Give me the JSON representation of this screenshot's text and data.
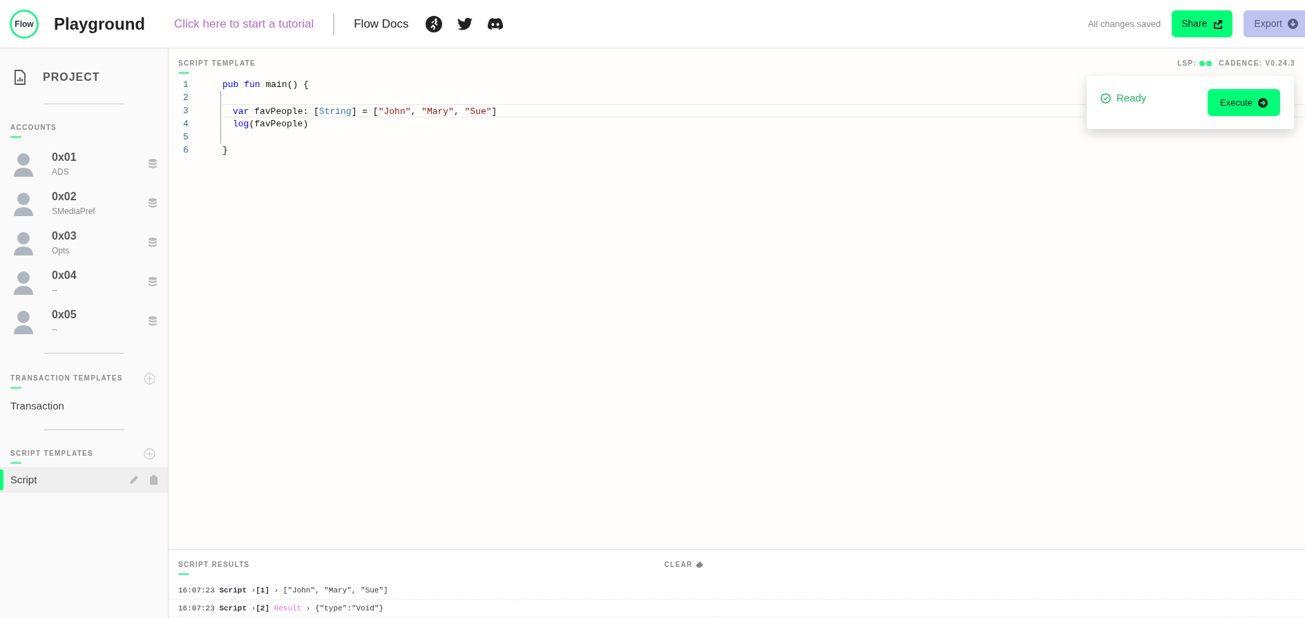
{
  "header": {
    "logo": "Flow",
    "title": "Playground",
    "tutorial_link": "Click here to start a tutorial",
    "docs_link": "Flow Docs",
    "save_status": "All changes saved",
    "share_button": "Share",
    "export_button": "Export"
  },
  "sidebar": {
    "project": "PROJECT",
    "accounts_heading": "ACCOUNTS",
    "accounts": [
      {
        "address": "0x01",
        "name": "ADS"
      },
      {
        "address": "0x02",
        "name": "SMediaPref"
      },
      {
        "address": "0x03",
        "name": "Opts"
      },
      {
        "address": "0x04",
        "name": "--"
      },
      {
        "address": "0x05",
        "name": "--"
      }
    ],
    "transaction_heading": "TRANSACTION TEMPLATES",
    "transactions": [
      {
        "label": "Transaction",
        "selected": false
      }
    ],
    "script_heading": "SCRIPT TEMPLATES",
    "scripts": [
      {
        "label": "Script",
        "selected": true
      }
    ]
  },
  "editor": {
    "heading": "SCRIPT TEMPLATE",
    "lsp_label": "LSP:",
    "cadence_version": "CADENCE: V0.24.3",
    "lines": [
      {
        "number": "1",
        "indented": false,
        "current": false,
        "tokens": [
          {
            "text": "pub fun",
            "kind": "keyword"
          },
          {
            "text": "main() {",
            "kind": "plain"
          }
        ]
      },
      {
        "number": "2",
        "current": false
      },
      {
        "number": "3",
        "indented": true,
        "current": true,
        "tokens": [
          {
            "text": "var",
            "kind": "keyword"
          },
          {
            "text": "favPeople: [",
            "kind": "plain"
          },
          {
            "text": "String",
            "kind": "type"
          },
          {
            "text": "] = [",
            "kind": "plain"
          },
          {
            "text": "\"John\"",
            "kind": "string"
          },
          {
            "text": ",",
            "kind": "plain"
          },
          {
            "text": "\"Mary\"",
            "kind": "string"
          },
          {
            "text": ",",
            "kind": "plain"
          },
          {
            "text": "\"Sue\"",
            "kind": "string"
          },
          {
            "text": "]",
            "kind": "plain"
          }
        ]
      },
      {
        "number": "4",
        "indented": true,
        "current": false,
        "tokens": [
          {
            "text": "log",
            "kind": "keyword"
          },
          {
            "text": "(favPeople)",
            "kind": "plain"
          }
        ]
      },
      {
        "number": "5",
        "current": false
      },
      {
        "number": "6",
        "indented": false,
        "current": false,
        "tokens": [
          {
            "text": "}",
            "kind": "plain"
          }
        ]
      }
    ],
    "status": "Ready",
    "execute_button": "Execute"
  },
  "results": {
    "heading": "SCRIPT RESULTS",
    "clear_button": "CLEAR",
    "rows": [
      {
        "time": "16:07:23",
        "source": "Script",
        "chevron_1": "›",
        "index": "[1]",
        "chevron_2": "›",
        "value": "[\"John\", \"Mary\", \"Sue\"]"
      },
      {
        "time": "16:07:23",
        "source": "Script",
        "chevron_1": "›",
        "index": "[2]",
        "tag": "Result",
        "chevron_2": "›",
        "value": "{\"type\":\"Void\"}"
      }
    ]
  }
}
